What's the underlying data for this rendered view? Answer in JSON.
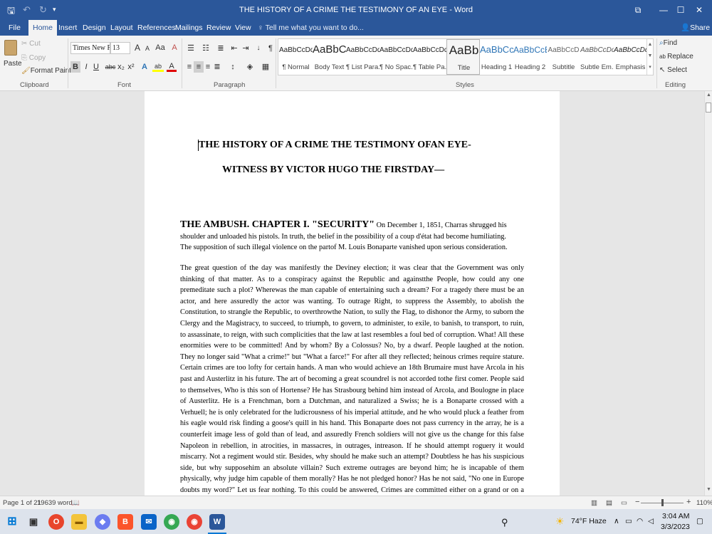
{
  "window": {
    "title": "THE HISTORY OF A CRIME THE TESTIMONY OF AN EYE - Word",
    "controls": {
      "restore_ribbon": "⧉",
      "minimize": "—",
      "maximize": "☐",
      "close": "✕"
    }
  },
  "quick_access": {
    "save": "🖫",
    "undo": "↶",
    "redo": "↻",
    "customize": "▾"
  },
  "tabs": [
    "File",
    "Home",
    "Insert",
    "Design",
    "Layout",
    "References",
    "Mailings",
    "Review",
    "View"
  ],
  "active_tab": "Home",
  "tell_me": "Tell me what you want to do...",
  "share": "Share",
  "clipboard": {
    "paste": "Paste",
    "cut": "Cut",
    "copy": "Copy",
    "format_painter": "Format Painter",
    "label": "Clipboard"
  },
  "font": {
    "name": "Times New Ro",
    "size": "13",
    "label": "Font",
    "grow": "A",
    "shrink": "A",
    "change_case": "Aa",
    "clear": "A",
    "bold": "B",
    "italic": "I",
    "underline": "U",
    "strike": "abc",
    "subscript": "x₂",
    "superscript": "x²",
    "text_effects": "A",
    "highlight": "ab",
    "font_color": "A"
  },
  "paragraph": {
    "label": "Paragraph",
    "show_marks": "¶"
  },
  "styles": {
    "label": "Styles",
    "items": [
      {
        "preview": "AaBbCcDd",
        "name": "¶ Normal"
      },
      {
        "preview": "AaBbC",
        "name": "Body Text"
      },
      {
        "preview": "AaBbCcDd",
        "name": "¶ List Para..."
      },
      {
        "preview": "AaBbCcDd",
        "name": "¶ No Spac..."
      },
      {
        "preview": "AaBbCcDd",
        "name": "¶ Table Pa..."
      },
      {
        "preview": "AaBb",
        "name": "Title"
      },
      {
        "preview": "AaBbCc",
        "name": "Heading 1"
      },
      {
        "preview": "AaBbCcE",
        "name": "Heading 2"
      },
      {
        "preview": "AaBbCcD",
        "name": "Subtitle"
      },
      {
        "preview": "AaBbCcDd",
        "name": "Subtle Em..."
      },
      {
        "preview": "AaBbCcDd",
        "name": "Emphasis"
      }
    ]
  },
  "editing": {
    "find": "Find",
    "replace": "Replace",
    "select": "Select",
    "label": "Editing"
  },
  "document": {
    "title_line1": "THE HISTORY OF A CRIME THE TESTIMONY OFAN EYE-",
    "title_line2": "WITNESS BY VICTOR HUGO THE FIRSTDAY—",
    "chapter_heading": "THE AMBUSH. CHAPTER I. \"SECURITY\"",
    "para1": " On December 1, 1851, Charras shrugged his shoulder and unloaded his pistols. In truth, the belief in the possibility of a coup d'état had become humiliating. The supposition of such illegal violence on the partof M. Louis Bonaparte vanished upon serious consideration.",
    "para2": "The great question of the day was manifestly the Deviney election; it was clear that the Government was only thinking of that matter. As to a conspiracy against the Republic and againstthe People, how could any one premeditate such a plot? Wherewas the man capable of entertaining such a dream? For a tragedy there must be an actor, and here assuredly the actor was wanting. To outrage Right, to suppress the Assembly, to abolish the Constitution, to strangle the Republic, to overthrowthe Nation, to sully the Flag, to dishonor the Army, to suborn the Clergy and the Magistracy, to succeed, to triumph, to govern, to administer, to exile, to banish, to transport, to ruin, to assassinate, to reign, with such complicities that the law at last resembles a foul bed of corruption. What! All these enormities were to be committed! And by whom? By a Colossus? No, by a dwarf. People laughed at the notion. They no longer said \"What a crime!\" but \"What a farce!\" For after all they reflected; heinous crimes require stature. Certain crimes are too lofty for certain hands. A man who would achieve an 18th Brumaire must have Arcola in his past and Austerlitz in his future. The art of becoming a great scoundrel is not accorded tothe first comer. People said to themselves, Who is this son of Hortense? He has Strasbourg behind him instead of Arcola, and Boulogne in place of Austerlitz. He is a Frenchman, born a Dutchman, and naturalized a Swiss; he is a Bonaparte crossed with a Verhuell; he is only celebrated for the ludicrousness of his imperial attitude, and he who would pluck a feather from his eagle would risk finding a goose's quill in his hand. This Bonaparte does not pass currency in the array, he is a counterfeit image less of gold than of lead, and assuredly French soldiers will not give us the change for this false Napoleon in rebellion, in atrocities, in massacres, in outrages, intreason. If he should attempt roguery it would miscarry. Not a regiment would stir. Besides, why should he make such an attempt? Doubtless he has his suspicious side, but why supposehim an absolute villain? Such extreme outrages are beyond him; he is incapable of them physically, why judge him capable of them morally? Has he not pledged honor? Has he not said, \"No one in Europe doubts my word?\" Let us fear nothing. To this could be answered, Crimes are committed either on a grand or on a mean scale. In the first category there is Caesar; in the second there is Mandrin. Caesar passes the Rubicon, Mandrin bestrides the gutter. But wise men interposed, \"Are we not prejudiced by offensive conjectures? This man has beenexiled and unfortunate."
  },
  "statusbar": {
    "page": "Page 1 of 21",
    "words": "19639 words",
    "zoom": "110%",
    "zoom_minus": "−",
    "zoom_plus": "+"
  },
  "taskbar": {
    "weather": "74°F  Haze",
    "time": "3:04 AM",
    "date": "3/3/2023",
    "apps": [
      "start",
      "task-view",
      "opera",
      "file-explorer",
      "copilot",
      "brave",
      "mail",
      "chrome",
      "chrome-2",
      "word"
    ]
  },
  "colors": {
    "word_blue": "#2b579a",
    "ribbon_bg": "#f3f3f3",
    "doc_bg": "#e6e6e6"
  }
}
